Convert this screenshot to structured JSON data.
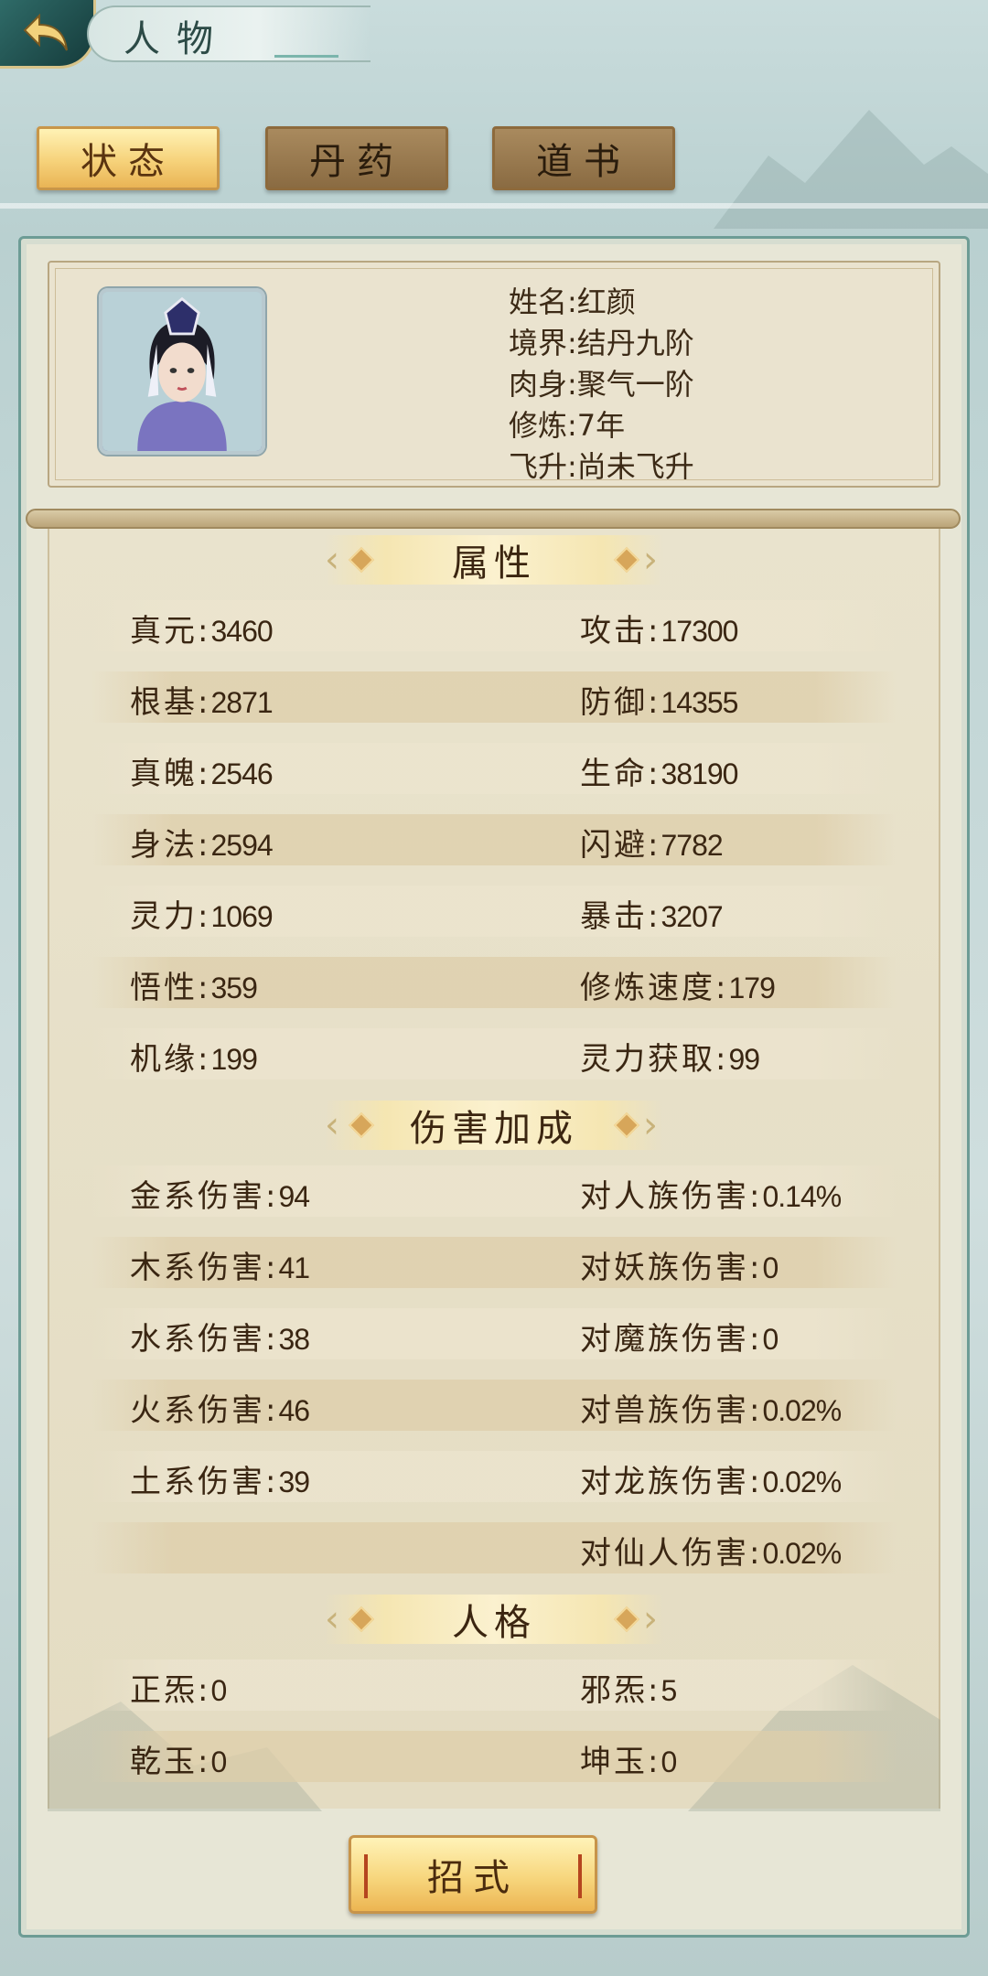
{
  "header": {
    "title": "人物",
    "back_icon": "back-arrow-icon"
  },
  "tabs": [
    {
      "label": "状态",
      "active": true
    },
    {
      "label": "丹药",
      "active": false
    },
    {
      "label": "道书",
      "active": false
    }
  ],
  "profile": {
    "name": "姓名:红颜",
    "realm": "境界:结丹九阶",
    "body": "肉身:聚气一阶",
    "cultivation": "修炼:7年",
    "ascension": "飞升:尚未飞升"
  },
  "sections": {
    "attributes": {
      "title": "属性",
      "rows": [
        [
          {
            "label": "真元:",
            "value": "3460"
          },
          {
            "label": "攻击:",
            "value": "17300"
          }
        ],
        [
          {
            "label": "根基:",
            "value": "2871"
          },
          {
            "label": "防御:",
            "value": "14355"
          }
        ],
        [
          {
            "label": "真魄:",
            "value": "2546"
          },
          {
            "label": "生命:",
            "value": "38190"
          }
        ],
        [
          {
            "label": "身法:",
            "value": "2594"
          },
          {
            "label": "闪避:",
            "value": "7782"
          }
        ],
        [
          {
            "label": "灵力:",
            "value": "1069"
          },
          {
            "label": "暴击:",
            "value": "3207"
          }
        ],
        [
          {
            "label": "悟性:",
            "value": "359"
          },
          {
            "label": "修炼速度:",
            "value": "179"
          }
        ],
        [
          {
            "label": "机缘:",
            "value": "199"
          },
          {
            "label": "灵力获取:",
            "value": "99"
          }
        ]
      ]
    },
    "damage": {
      "title": "伤害加成",
      "rows": [
        [
          {
            "label": "金系伤害:",
            "value": "94"
          },
          {
            "label": "对人族伤害:",
            "value": "0.14%"
          }
        ],
        [
          {
            "label": "木系伤害:",
            "value": "41"
          },
          {
            "label": "对妖族伤害:",
            "value": "0"
          }
        ],
        [
          {
            "label": "水系伤害:",
            "value": "38"
          },
          {
            "label": "对魔族伤害:",
            "value": "0"
          }
        ],
        [
          {
            "label": "火系伤害:",
            "value": "46"
          },
          {
            "label": "对兽族伤害:",
            "value": "0.02%"
          }
        ],
        [
          {
            "label": "土系伤害:",
            "value": "39"
          },
          {
            "label": "对龙族伤害:",
            "value": "0.02%"
          }
        ],
        [
          null,
          {
            "label": "对仙人伤害:",
            "value": "0.02%"
          }
        ]
      ]
    },
    "personality": {
      "title": "人格",
      "rows": [
        [
          {
            "label": "正炁:",
            "value": "0"
          },
          {
            "label": "邪炁:",
            "value": "5"
          }
        ],
        [
          {
            "label": "乾玉:",
            "value": "0"
          },
          {
            "label": "坤玉:",
            "value": "0"
          }
        ]
      ]
    }
  },
  "footer": {
    "skill_button": "招式"
  }
}
